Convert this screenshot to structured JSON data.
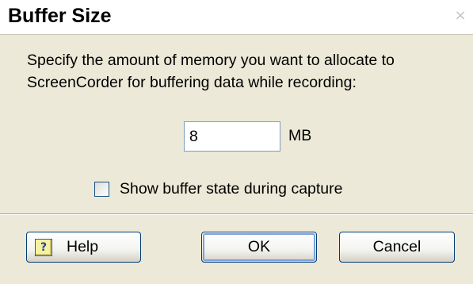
{
  "window": {
    "title": "Buffer Size",
    "close_glyph": "×"
  },
  "description": {
    "line1": "Specify the amount of memory you want to allocate to",
    "line2": "ScreenCorder for buffering data while recording:"
  },
  "memory": {
    "value": "8",
    "unit": "MB"
  },
  "option": {
    "label": "Show buffer state during capture",
    "checked": false
  },
  "buttons": {
    "help_icon_glyph": "?",
    "help_label": "Help",
    "ok_label": "OK",
    "cancel_label": "Cancel"
  }
}
